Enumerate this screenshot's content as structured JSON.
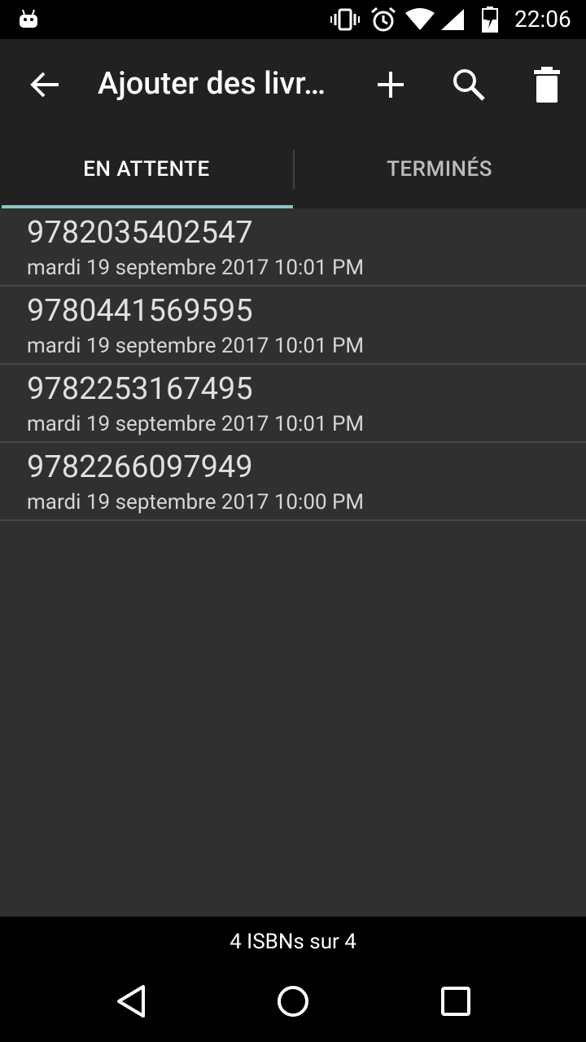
{
  "status_bar": {
    "time": "22:06",
    "icons": [
      "android-icon",
      "vibrate-icon",
      "alarm-icon",
      "wifi-icon",
      "signal-icon",
      "battery-icon"
    ]
  },
  "app_bar": {
    "title": "Ajouter des livr…",
    "actions": [
      "back-arrow-icon",
      "add-icon",
      "search-icon",
      "delete-icon"
    ]
  },
  "tabs": [
    {
      "label": "EN ATTENTE",
      "selected": true
    },
    {
      "label": "TERMINÉS",
      "selected": false
    }
  ],
  "items": [
    {
      "isbn": "9782035402547",
      "date": "mardi 19 septembre 2017 10:01 PM"
    },
    {
      "isbn": "9780441569595",
      "date": "mardi 19 septembre 2017 10:01 PM"
    },
    {
      "isbn": "9782253167495",
      "date": "mardi 19 septembre 2017 10:01 PM"
    },
    {
      "isbn": "9782266097949",
      "date": "mardi 19 septembre 2017 10:00 PM"
    }
  ],
  "footer": {
    "count_text": "4 ISBNs sur 4"
  },
  "colors": {
    "accent": "#80cbc4",
    "background": "#303030",
    "app_bar": "#212121"
  }
}
